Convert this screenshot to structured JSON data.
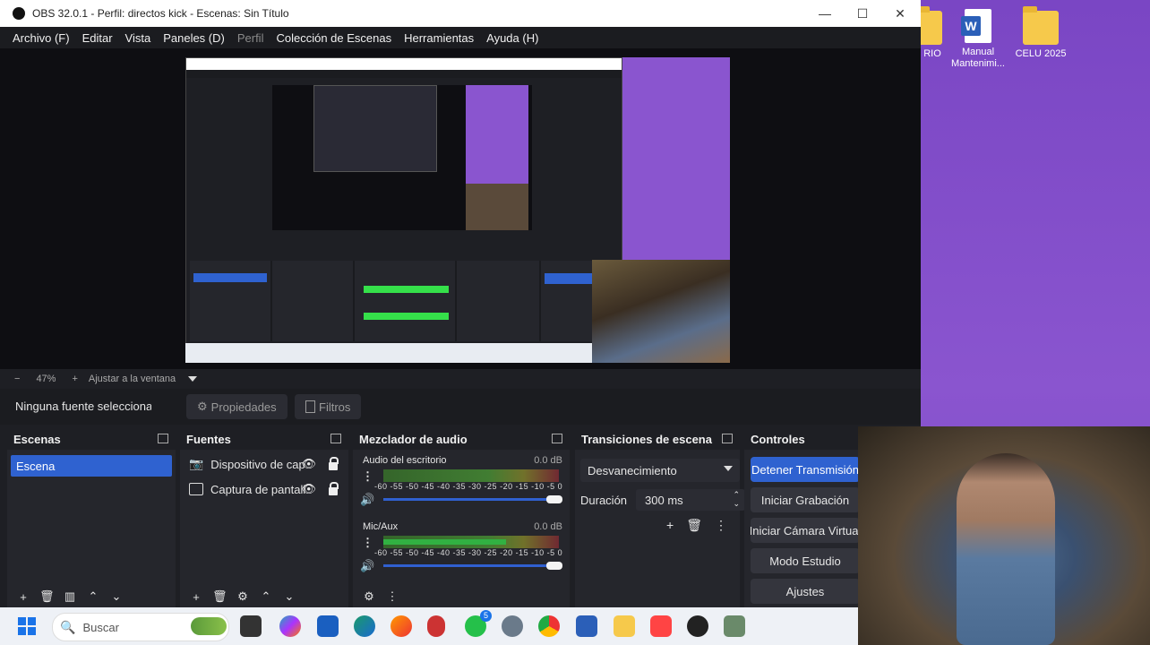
{
  "desktop": {
    "icons": [
      {
        "label": "RIO"
      },
      {
        "label": "Manual Mantenimi..."
      },
      {
        "label": "CELU 2025"
      }
    ]
  },
  "window": {
    "title": "OBS 32.0.1 - Perfil: directos kick - Escenas: Sin Título",
    "controls": {
      "minimize": "—",
      "maximize": "☐",
      "close": "✕"
    }
  },
  "menu": {
    "items": [
      "Archivo (F)",
      "Editar",
      "Vista",
      "Paneles (D)",
      "Perfil",
      "Colección de Escenas",
      "Herramientas",
      "Ayuda (H)"
    ]
  },
  "zoom": {
    "minus": "−",
    "value": "47%",
    "plus": "+",
    "fit_label": "Ajustar a la ventana"
  },
  "source_bar": {
    "no_selection": "Ninguna fuente seleccionada",
    "properties": "Propiedades",
    "filters": "Filtros"
  },
  "scenes": {
    "title": "Escenas",
    "items": [
      "Escena"
    ]
  },
  "sources": {
    "title": "Fuentes",
    "items": [
      "Dispositivo de captura",
      "Captura de pantalla"
    ]
  },
  "mixer": {
    "title": "Mezclador de audio",
    "channels": [
      {
        "name": "Audio del escritorio",
        "db": "0.0 dB",
        "level": 0.0
      },
      {
        "name": "Mic/Aux",
        "db": "0.0 dB",
        "level": 0.7
      }
    ],
    "ticks": "-60 -55 -50 -45 -40 -35 -30 -25 -20 -15 -10 -5 0"
  },
  "transitions": {
    "title": "Transiciones de escena",
    "selected": "Desvanecimiento",
    "duration_label": "Duración",
    "duration_value": "300 ms"
  },
  "controls": {
    "title": "Controles",
    "buttons": [
      "Detener Transmisión",
      "Iniciar Grabación",
      "Iniciar Cámara Virtual",
      "Modo Estudio",
      "Ajustes"
    ]
  },
  "taskbar": {
    "search_placeholder": "Buscar",
    "whatsapp_badge": "5"
  },
  "colors": {
    "accent": "#2f62d0",
    "bg": "#1e1f24",
    "desktop": "#8a55cf"
  }
}
